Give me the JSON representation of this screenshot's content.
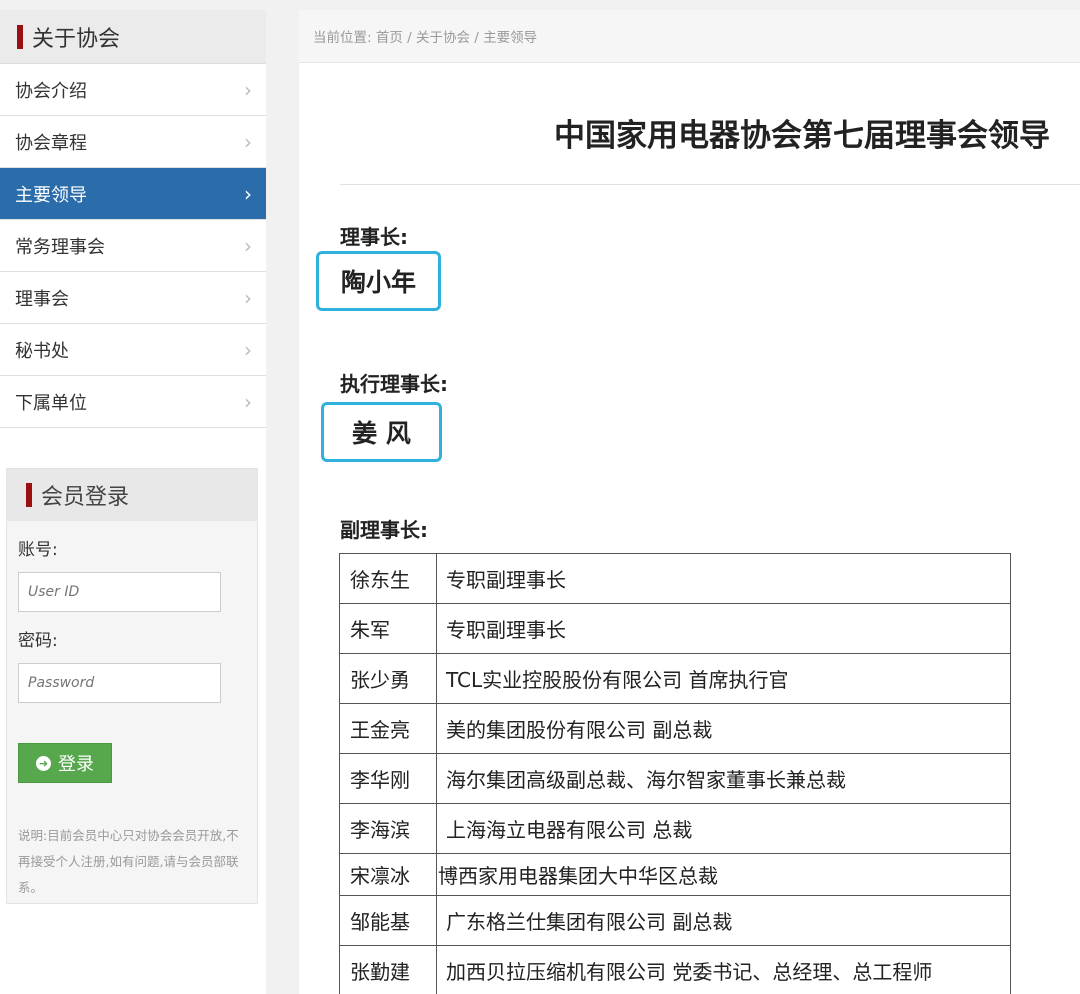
{
  "sidebar": {
    "title": "关于协会",
    "items": [
      {
        "label": "协会介绍",
        "chevron": "›",
        "active": false
      },
      {
        "label": "协会章程",
        "chevron": "›",
        "active": false
      },
      {
        "label": "主要领导",
        "chevron": "›",
        "active": true
      },
      {
        "label": "常务理事会",
        "chevron": "›",
        "active": false
      },
      {
        "label": "理事会",
        "chevron": "›",
        "active": false
      },
      {
        "label": "秘书处",
        "chevron": "›",
        "active": false
      },
      {
        "label": "下属单位",
        "chevron": "›",
        "active": false
      }
    ]
  },
  "login": {
    "title": "会员登录",
    "account_label": "账号:",
    "account_placeholder": "User ID",
    "password_label": "密码:",
    "password_placeholder": "Password",
    "button_label": "登录",
    "note": "说明:目前会员中心只对协会会员开放,不再接受个人注册,如有问题,请与会员部联系。"
  },
  "breadcrumb": "当前位置: 首页 / 关于协会 / 主要领导",
  "page_title": "中国家用电器协会第七届理事会领导",
  "chairman": {
    "label": "理事长:",
    "name": "陶小年"
  },
  "executive": {
    "label": "执行理事长:",
    "name": "姜 风"
  },
  "vice": {
    "label": "副理事长:",
    "rows": [
      {
        "name": "徐东生",
        "position": "专职副理事长"
      },
      {
        "name": "朱军",
        "position": "专职副理事长"
      },
      {
        "name": "张少勇",
        "position": "TCL实业控股股份有限公司 首席执行官"
      },
      {
        "name": "王金亮",
        "position": "美的集团股份有限公司 副总裁"
      },
      {
        "name": "李华刚",
        "position": "海尔集团高级副总裁、海尔智家董事长兼总裁"
      },
      {
        "name": "李海滨",
        "position": "上海海立电器有限公司 总裁"
      },
      {
        "name": "宋凛冰",
        "position": "博西家用电器集团大中华区总裁"
      },
      {
        "name": "邹能基",
        "position": "广东格兰仕集团有限公司 副总裁"
      },
      {
        "name": "张勤建",
        "position": "加西贝拉压缩机有限公司 党委书记、总经理、总工程师"
      }
    ]
  },
  "colors": {
    "accent_red": "#9b0f13",
    "active_blue": "#2b6cab",
    "name_box_border": "#2eb1dd",
    "login_green": "#57a84c"
  }
}
